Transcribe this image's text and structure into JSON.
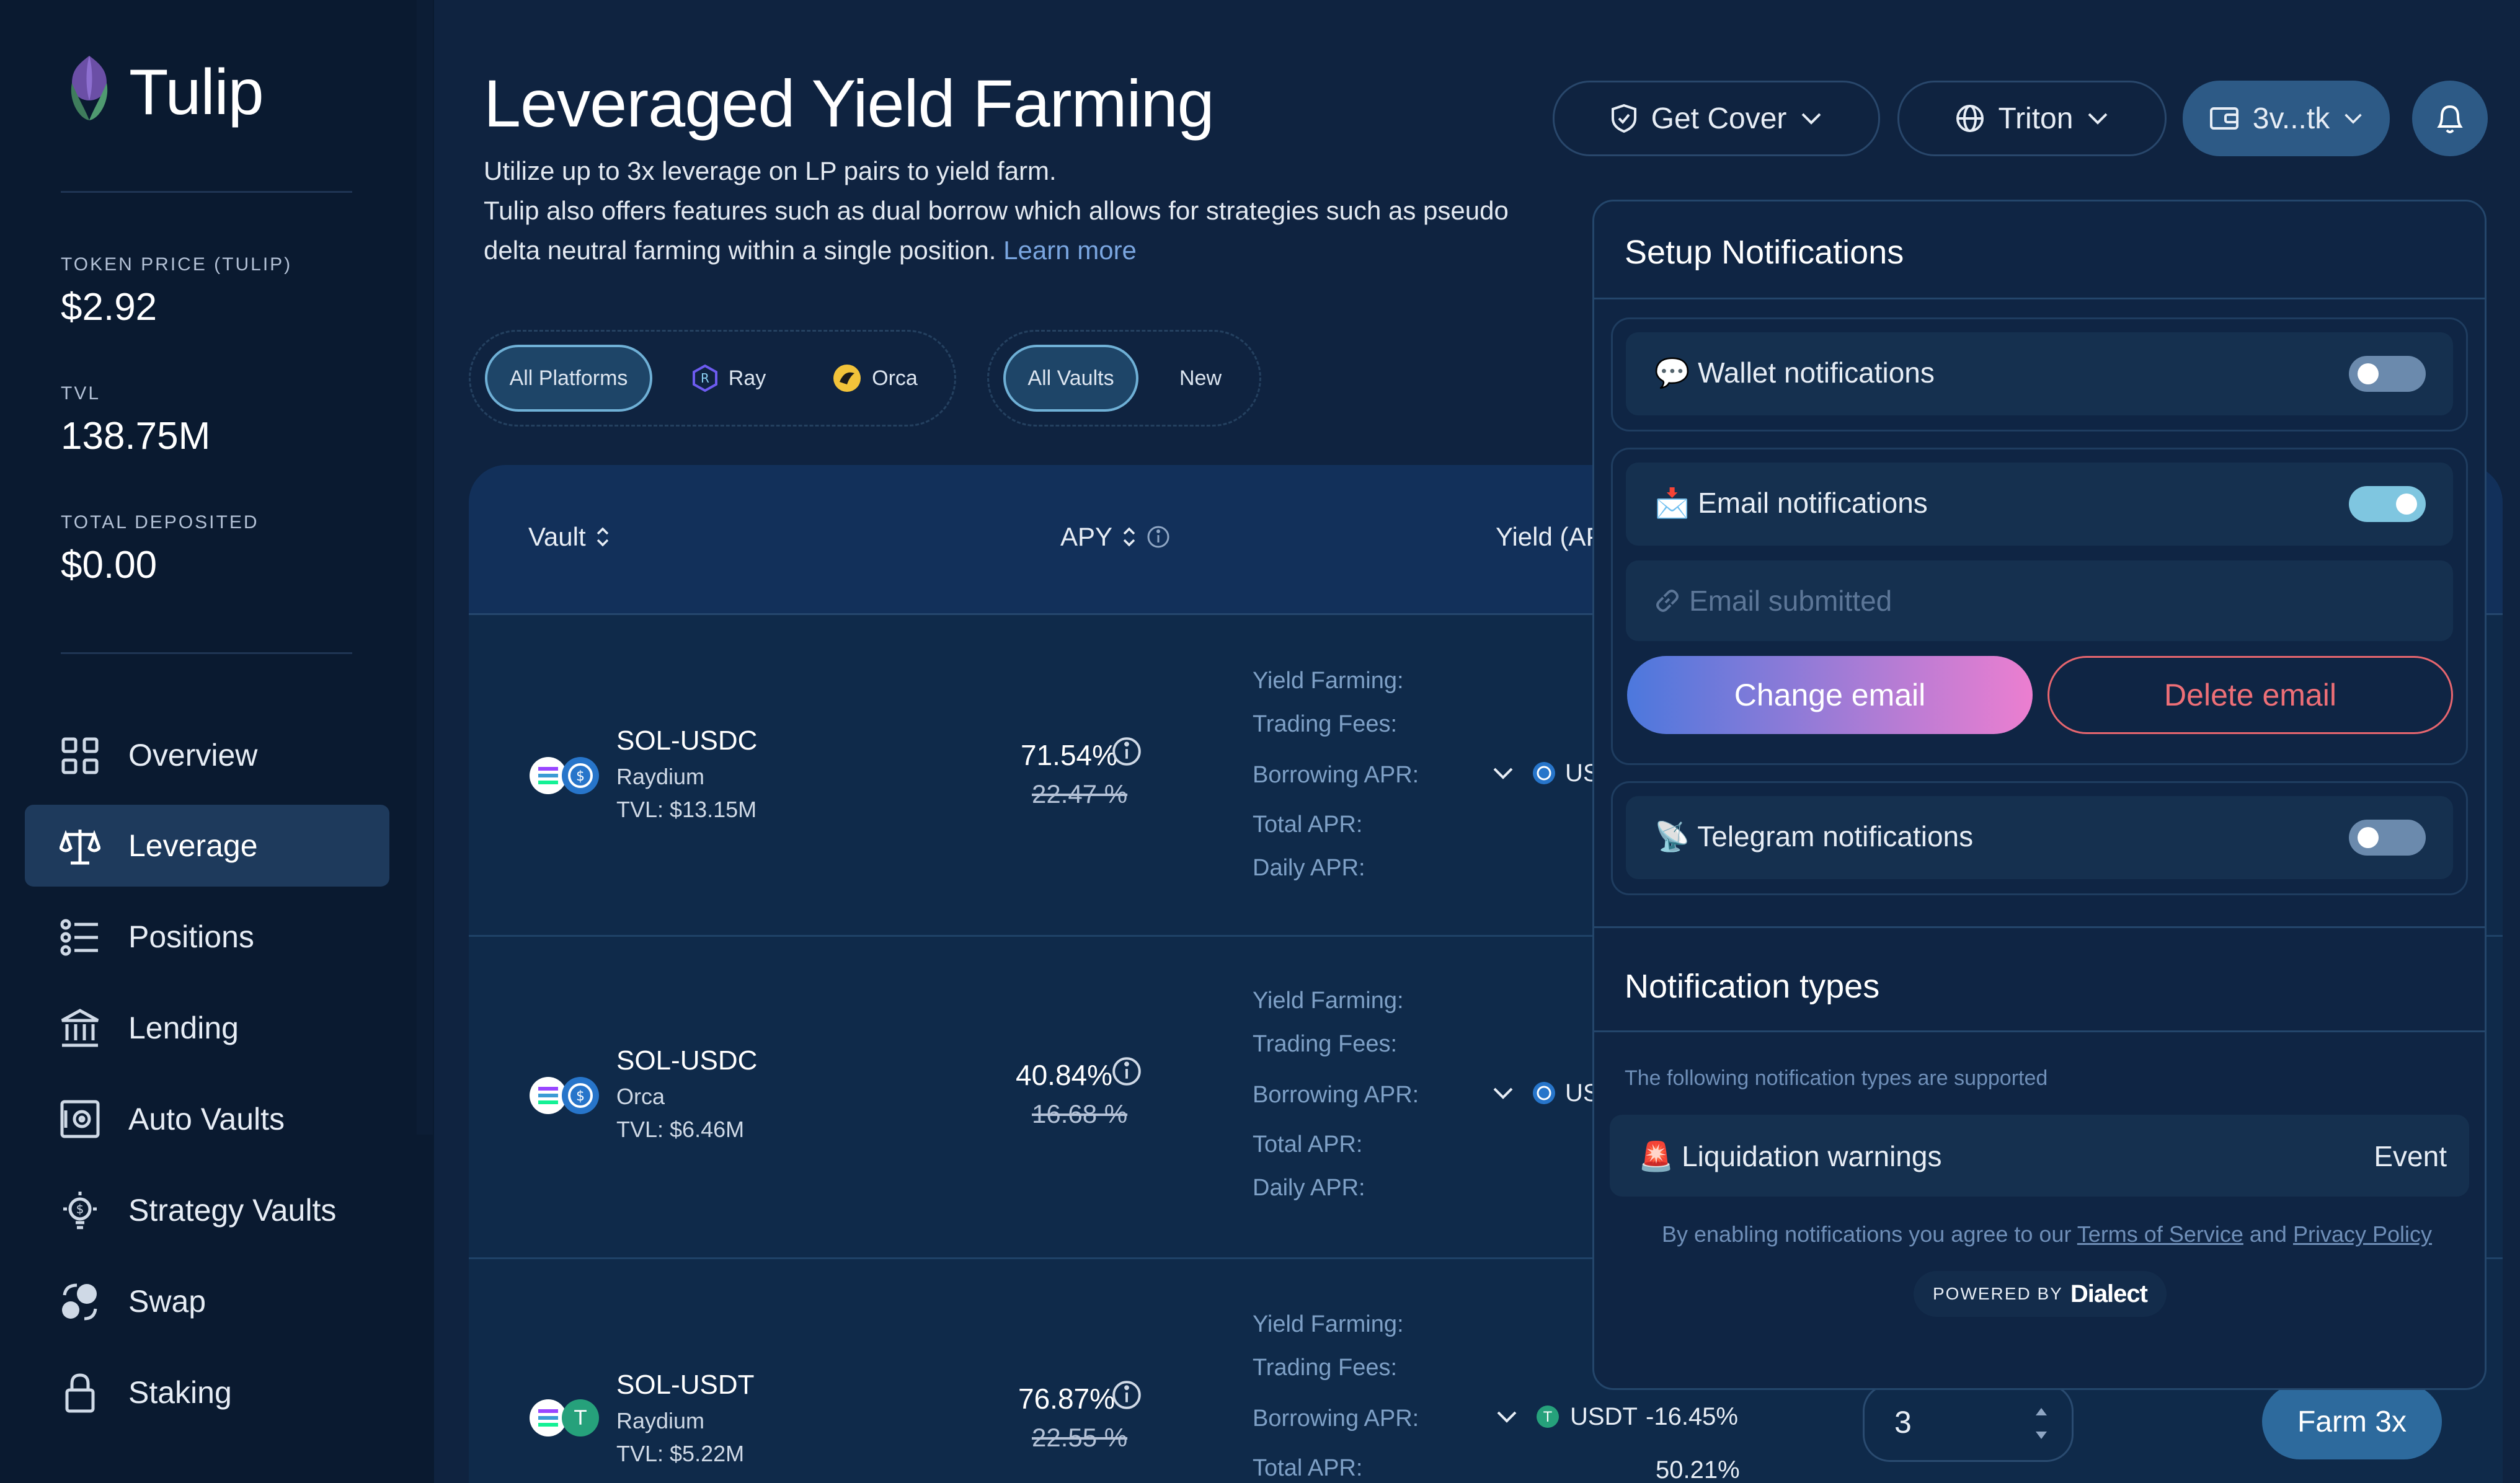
{
  "app": {
    "name": "Tulip"
  },
  "stats": [
    {
      "label": "TOKEN PRICE (TULIP)",
      "value": "$2.92"
    },
    {
      "label": "TVL",
      "value": "138.75M"
    },
    {
      "label": "TOTAL DEPOSITED",
      "value": "$0.00"
    }
  ],
  "nav": [
    {
      "label": "Overview",
      "icon": "grid-icon"
    },
    {
      "label": "Leverage",
      "icon": "scales-icon",
      "active": true
    },
    {
      "label": "Positions",
      "icon": "list-icon"
    },
    {
      "label": "Lending",
      "icon": "bank-icon"
    },
    {
      "label": "Auto Vaults",
      "icon": "safe-icon"
    },
    {
      "label": "Strategy Vaults",
      "icon": "bulb-dollar-icon"
    },
    {
      "label": "Swap",
      "icon": "swap-icon"
    },
    {
      "label": "Staking",
      "icon": "lock-icon"
    }
  ],
  "header": {
    "title": "Leveraged Yield Farming",
    "desc_line1": "Utilize up to 3x leverage on LP pairs to yield farm.",
    "desc_line2": "Tulip also offers features such as dual borrow which allows for strategies such as pseudo",
    "desc_line3": "delta neutral farming within a single position.",
    "learn_more": "Learn more",
    "get_cover": "Get Cover",
    "network": "Triton",
    "wallet": "3v...tk"
  },
  "filters": {
    "platforms": [
      "All Platforms",
      "Ray",
      "Orca"
    ],
    "vaults": [
      "All Vaults",
      "New"
    ]
  },
  "table": {
    "headers": {
      "vault": "Vault",
      "apy": "APY",
      "yield": "Yield (AP"
    },
    "yield_labels": [
      "Yield Farming:",
      "Trading Fees:",
      "Borrowing APR:",
      "Total APR:",
      "Daily APR:"
    ],
    "rows": [
      {
        "pair": "SOL-USDC",
        "platform": "Raydium",
        "tvl": "TVL: $13.15M",
        "apy": "71.54%",
        "apy_old": "22.47 %",
        "borrow_token": "US"
      },
      {
        "pair": "SOL-USDC",
        "platform": "Orca",
        "tvl": "TVL: $6.46M",
        "apy": "40.84%",
        "apy_old": "16.68 %",
        "borrow_token": "US"
      },
      {
        "pair": "SOL-USDT",
        "platform": "Raydium",
        "tvl": "TVL: $5.22M",
        "apy": "76.87%",
        "apy_old": "22.55 %",
        "borrow_token": "USDT",
        "borrow_apr": "-16.45%",
        "total_apr": "50.21%",
        "leverage": "3",
        "farm_label": "Farm 3x"
      }
    ]
  },
  "notifications": {
    "title": "Setup Notifications",
    "wallet": {
      "emoji": "💬",
      "label": "Wallet notifications",
      "enabled": false
    },
    "email": {
      "emoji": "📩",
      "label": "Email notifications",
      "enabled": true,
      "placeholder": "Email submitted"
    },
    "change_email": "Change email",
    "delete_email": "Delete email",
    "telegram": {
      "emoji": "📡",
      "label": "Telegram notifications",
      "enabled": false
    },
    "types_title": "Notification types",
    "types_desc": "The following notification types are supported",
    "types": [
      {
        "emoji": "🚨",
        "label": "Liquidation warnings",
        "kind": "Event"
      }
    ],
    "terms_prefix": "By enabling notifications you agree to our",
    "terms_link": "Terms of Service",
    "terms_and": "and",
    "privacy_link": "Privacy Policy",
    "powered_by": "POWERED BY",
    "brand": "Dialect"
  },
  "colors": {
    "background": "#0f2340",
    "sidebar": "#0a1a30",
    "accent": "#2d5a86",
    "link": "#7aa6e0",
    "danger": "#ee6f77"
  }
}
